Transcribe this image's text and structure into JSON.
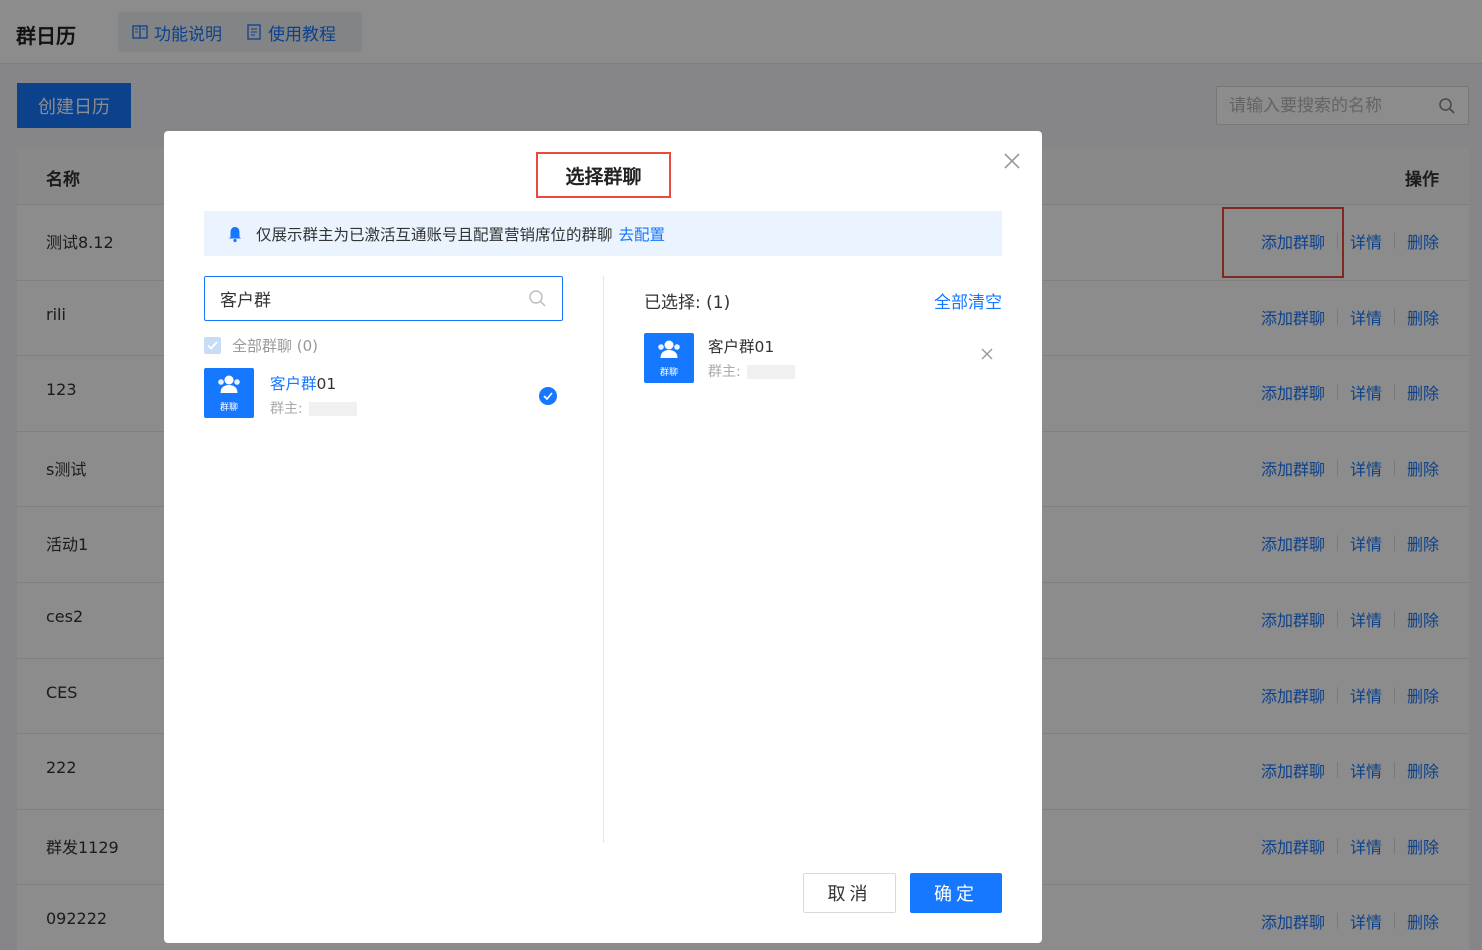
{
  "header": {
    "title": "群日历",
    "links": [
      {
        "label": "功能说明",
        "icon": "book-icon"
      },
      {
        "label": "使用教程",
        "icon": "document-icon"
      }
    ]
  },
  "toolbar": {
    "create_label": "创建日历",
    "search_placeholder": "请输入要搜索的名称"
  },
  "table": {
    "col_name": "名称",
    "col_ops": "操作",
    "rows": [
      {
        "name": "测试8.12"
      },
      {
        "name": "rili"
      },
      {
        "name": "123"
      },
      {
        "name": "s测试"
      },
      {
        "name": "活动1"
      },
      {
        "name": "ces2"
      },
      {
        "name": "CES"
      },
      {
        "name": "222"
      },
      {
        "name": "群发1129"
      },
      {
        "name": "092222"
      }
    ],
    "ops": {
      "add_group": "添加群聊",
      "detail": "详情",
      "delete": "删除"
    }
  },
  "modal": {
    "title": "选择群聊",
    "notice": {
      "text": "仅展示群主为已激活互通账号且配置营销席位的群聊",
      "link": "去配置"
    },
    "search_value": "客户群",
    "all_groups_label": "全部群聊 (0)",
    "results": [
      {
        "name_highlight": "客户群",
        "name_rest": "01",
        "owner_label": "群主:",
        "avatar_label": "群聊",
        "checked": true
      }
    ],
    "selected_label": "已选择: (1)",
    "clear_all": "全部清空",
    "selected": [
      {
        "name": "客户群01",
        "owner_label": "群主:",
        "avatar_label": "群聊"
      }
    ],
    "cancel_label": "取消",
    "ok_label": "确定"
  },
  "colors": {
    "primary": "#1677ff",
    "highlight_border": "#e84a3d",
    "notice_bg": "#eaf3fe"
  }
}
